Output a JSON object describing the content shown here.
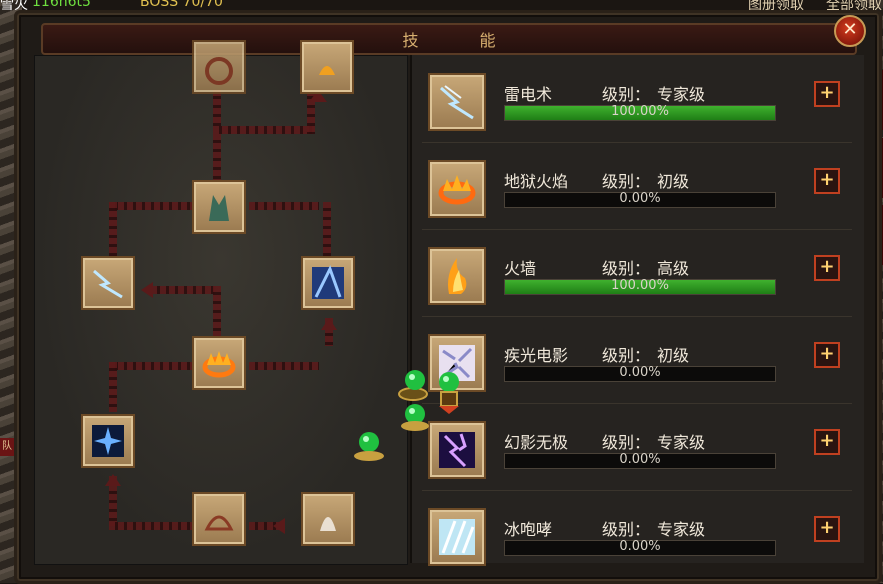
{
  "window": {
    "title": "技    能",
    "close_glyph": "✕"
  },
  "top_bar": {
    "left_label": "雪火",
    "green_text": "116h6t5",
    "boss_text": "BOSS  70/70",
    "right_text_1": "图册领取",
    "right_text_2": "全部领取"
  },
  "left_stub_label": "队",
  "skills": [
    {
      "name": "雷电术",
      "level_label": "级别：",
      "level": "专家级",
      "progress": 1.0,
      "progress_text": "100.00%",
      "icon": "lightning-icon"
    },
    {
      "name": "地狱火焰",
      "level_label": "级别：",
      "level": "初级",
      "progress": 0.0,
      "progress_text": "0.00%",
      "icon": "fire-ring-icon"
    },
    {
      "name": "火墙",
      "level_label": "级别：",
      "level": "高级",
      "progress": 1.0,
      "progress_text": "100.00%",
      "icon": "fire-wall-icon"
    },
    {
      "name": "疾光电影",
      "level_label": "级别：",
      "level": "初级",
      "progress": 0.0,
      "progress_text": "0.00%",
      "icon": "light-beam-icon"
    },
    {
      "name": "幻影无极",
      "level_label": "级别：",
      "level": "专家级",
      "progress": 0.0,
      "progress_text": "0.00%",
      "icon": "purple-lightning-icon"
    },
    {
      "name": "冰咆哮",
      "level_label": "级别：",
      "level": "专家级",
      "progress": 0.0,
      "progress_text": "0.00%",
      "icon": "ice-roar-icon"
    }
  ],
  "plus_glyph": "+",
  "colors": {
    "progress_fill": "#2fa020",
    "title": "#d8b070",
    "plus_border": "#c04020"
  }
}
